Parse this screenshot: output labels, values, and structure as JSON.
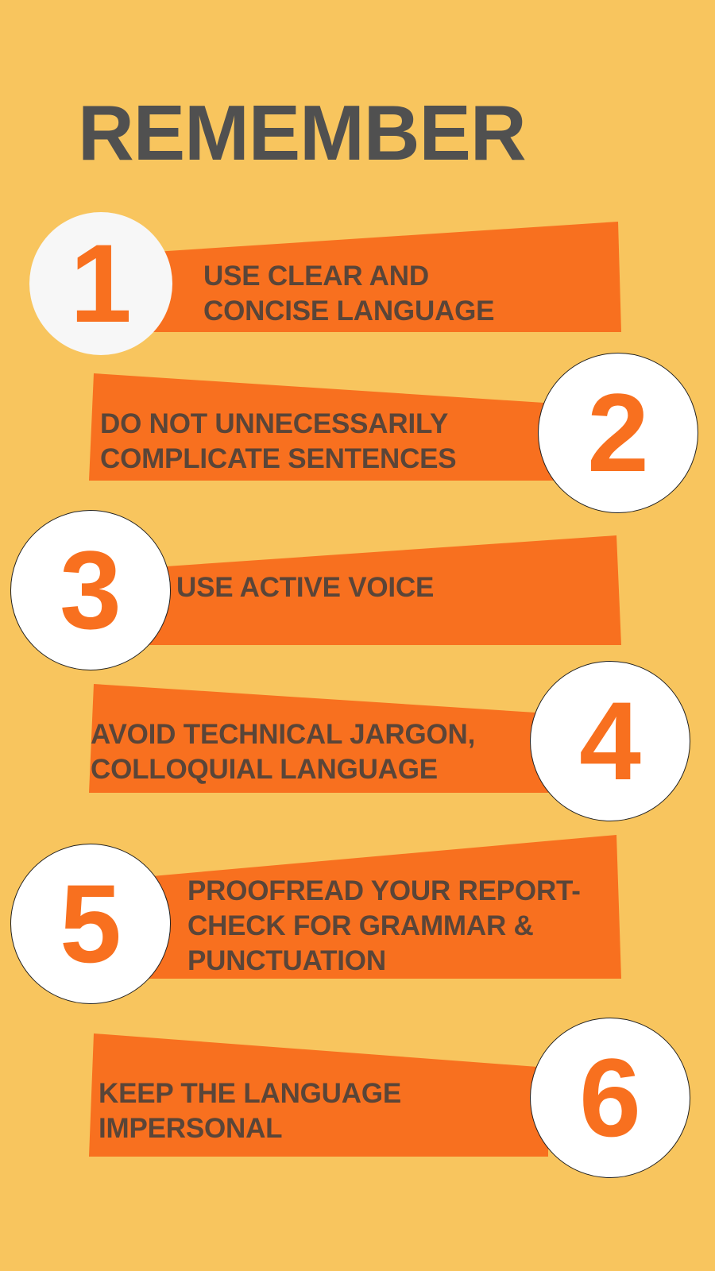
{
  "title": "REMEMBER",
  "items": [
    {
      "number": "1",
      "text": "USE CLEAR AND\nCONCISE LANGUAGE"
    },
    {
      "number": "2",
      "text": "DO NOT UNNECESSARILY\nCOMPLICATE SENTENCES"
    },
    {
      "number": "3",
      "text": "USE ACTIVE VOICE"
    },
    {
      "number": "4",
      "text": "AVOID TECHNICAL JARGON,\nCOLLOQUIAL LANGUAGE"
    },
    {
      "number": "5",
      "text": "PROOFREAD YOUR REPORT-\nCHECK FOR GRAMMAR &\nPUNCTUATION"
    },
    {
      "number": "6",
      "text": "KEEP THE LANGUAGE\nIMPERSONAL"
    }
  ],
  "colors": {
    "background": "#f8c55e",
    "banner": "#f8701f",
    "title": "#505050",
    "item_text": "#5a4538",
    "badge": "#ffffff"
  }
}
